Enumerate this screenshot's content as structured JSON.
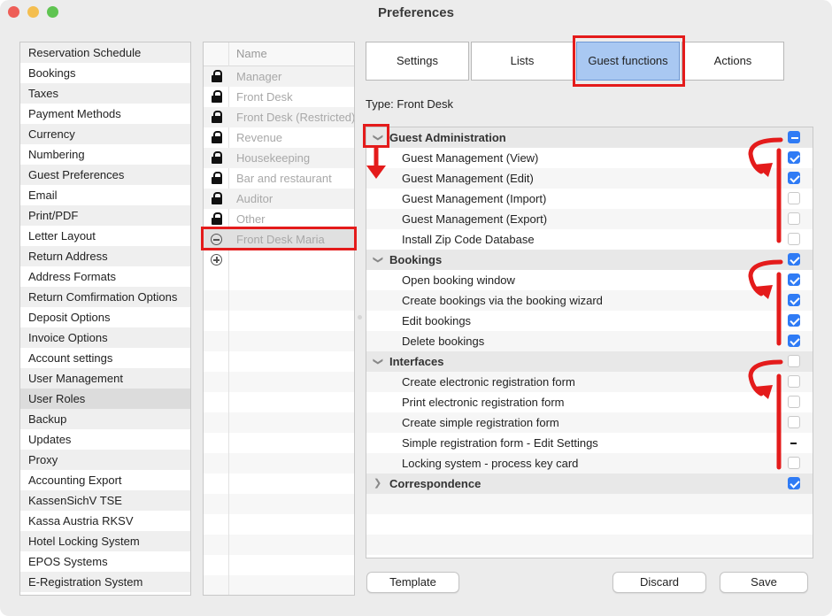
{
  "window": {
    "title": "Preferences"
  },
  "categories": [
    "Reservation Schedule",
    "Bookings",
    "Taxes",
    "Payment Methods",
    "Currency",
    "Numbering",
    "Guest Preferences",
    "Email",
    "Print/PDF",
    "Letter Layout",
    "Return Address",
    "Address Formats",
    "Return Comfirmation Options",
    "Deposit Options",
    "Invoice Options",
    "Account settings",
    "User Management",
    "User Roles",
    "Backup",
    "Updates",
    "Proxy",
    "Accounting Export",
    "KassenSichV TSE",
    "Kassa Austria RKSV",
    "Hotel Locking System",
    "EPOS Systems",
    "E-Registration System"
  ],
  "selected_category": "User Roles",
  "roles": {
    "header": "Name",
    "items": [
      {
        "name": "Manager",
        "icon": "lock-icon"
      },
      {
        "name": "Front Desk",
        "icon": "lock-icon"
      },
      {
        "name": "Front Desk (Restricted)",
        "icon": "lock-icon"
      },
      {
        "name": "Revenue",
        "icon": "lock-icon"
      },
      {
        "name": "Housekeeping",
        "icon": "lock-icon"
      },
      {
        "name": "Bar and restaurant",
        "icon": "lock-icon"
      },
      {
        "name": "Auditor",
        "icon": "lock-icon"
      },
      {
        "name": "Other",
        "icon": "lock-icon"
      },
      {
        "name": "Front Desk Maria",
        "icon": "remove-circle-icon"
      }
    ],
    "add_icon": "add-circle-icon"
  },
  "tabs": [
    {
      "label": "Settings",
      "active": false
    },
    {
      "label": "Lists",
      "active": false
    },
    {
      "label": "Guest functions",
      "active": true
    },
    {
      "label": "Actions",
      "active": false
    }
  ],
  "type_label": "Type: Front Desk",
  "groups": [
    {
      "label": "Guest Administration",
      "expanded": true,
      "state": "mixed",
      "items": [
        {
          "label": "Guest Management (View)",
          "state": "checked"
        },
        {
          "label": "Guest Management (Edit)",
          "state": "checked"
        },
        {
          "label": "Guest Management (Import)",
          "state": "unchecked"
        },
        {
          "label": "Guest Management (Export)",
          "state": "unchecked"
        },
        {
          "label": "Install Zip Code Database",
          "state": "unchecked"
        }
      ]
    },
    {
      "label": "Bookings",
      "expanded": true,
      "state": "checked",
      "items": [
        {
          "label": "Open booking window",
          "state": "checked"
        },
        {
          "label": "Create bookings via the booking wizard",
          "state": "checked"
        },
        {
          "label": "Edit bookings",
          "state": "checked"
        },
        {
          "label": "Delete bookings",
          "state": "checked"
        }
      ]
    },
    {
      "label": "Interfaces",
      "expanded": true,
      "state": "unchecked",
      "items": [
        {
          "label": "Create electronic registration form",
          "state": "unchecked"
        },
        {
          "label": "Print electronic registration form",
          "state": "unchecked"
        },
        {
          "label": "Create simple registration form",
          "state": "unchecked"
        },
        {
          "label": "Simple registration form - Edit Settings",
          "state": "dash"
        },
        {
          "label": "Locking system - process key card",
          "state": "unchecked"
        }
      ]
    },
    {
      "label": "Correspondence",
      "expanded": false,
      "state": "checked",
      "items": []
    }
  ],
  "buttons": {
    "template": "Template",
    "discard": "Discard",
    "save": "Save"
  },
  "colors": {
    "annotation": "#e41b1b",
    "accent": "#2f7bf5",
    "active_tab": "#a9c8f2"
  }
}
